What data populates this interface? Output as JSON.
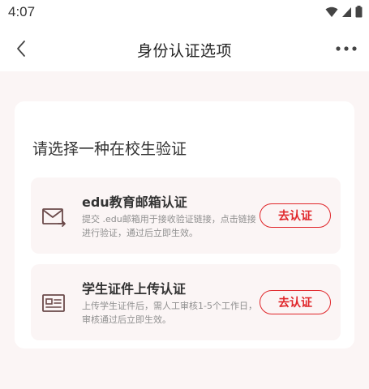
{
  "status_bar": {
    "time": "4:07"
  },
  "app_bar": {
    "title": "身份认证选项"
  },
  "card": {
    "heading": "请选择一种在校生验证",
    "options": [
      {
        "title": "edu教育邮箱认证",
        "description": "提交 .edu邮箱用于接收验证链接，点击链接进行验证，通过后立即生效。",
        "button_label": "去认证",
        "icon": "mail-icon"
      },
      {
        "title": "学生证件上传认证",
        "description": "上传学生证件后，需人工审核1-5个工作日，审核通过后立即生效。",
        "button_label": "去认证",
        "icon": "id-card-icon"
      }
    ]
  },
  "colors": {
    "accent": "#e0262a",
    "page_background": "#fbf5f5",
    "option_background": "#fbf5f5",
    "icon_color": "#6b4a4a"
  }
}
